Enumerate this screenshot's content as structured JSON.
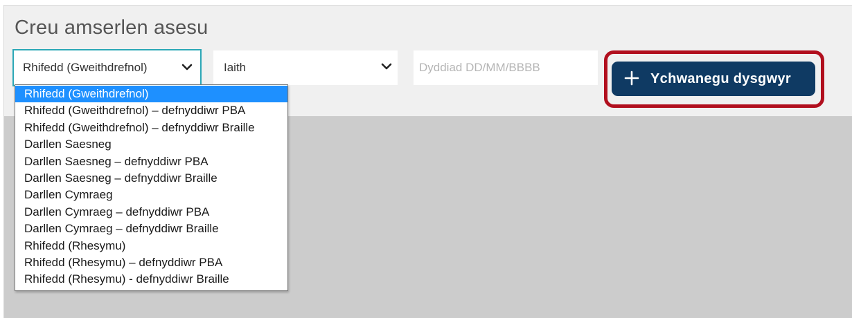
{
  "page": {
    "title": "Creu amserlen asesu"
  },
  "filters": {
    "subject_select": {
      "value": "Rhifedd (Gweithdrefnol)",
      "chevron_icon": "chevron-down-icon"
    },
    "language_select": {
      "value": "Iaith",
      "chevron_icon": "chevron-down-icon"
    },
    "date_input": {
      "value": "",
      "placeholder": "Dyddiad DD/MM/BBBB"
    }
  },
  "actions": {
    "add_learner": {
      "icon": "plus-icon",
      "label": "Ychwanegu dysgwyr"
    }
  },
  "dropdown": {
    "selected_index": 0,
    "options": [
      "Rhifedd (Gweithdrefnol)",
      "Rhifedd (Gweithdrefnol) – defnyddiwr PBA",
      "Rhifedd (Gweithdrefnol) – defnyddiwr Braille",
      "Darllen Saesneg",
      "Darllen Saesneg – defnyddiwr PBA",
      "Darllen Saesneg – defnyddiwr Braille",
      "Darllen Cymraeg",
      "Darllen Cymraeg – defnyddiwr PBA",
      "Darllen Cymraeg – defnyddiwr Braille",
      "Rhifedd (Rhesymu)",
      "Rhifedd (Rhesymu) – defnyddiwr PBA",
      "Rhifedd (Rhesymu) - defnyddiwr Braille"
    ]
  },
  "colors": {
    "panel_bg": "#f0f0f0",
    "page_bg": "#cccccc",
    "focus_border": "#2aa7b6",
    "button_bg": "#0f3a63",
    "highlight_ring": "#b10f1e",
    "selected_option": "#1e90ff"
  }
}
